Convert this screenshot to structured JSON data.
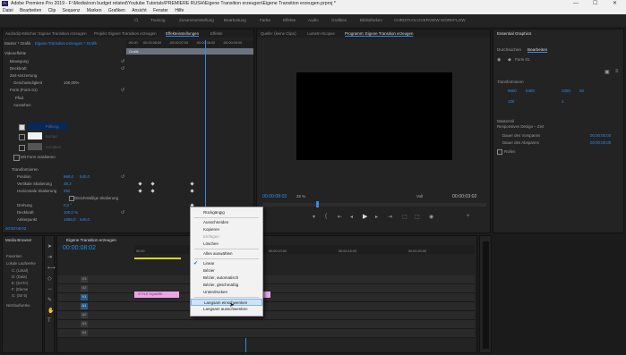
{
  "window": {
    "title": "Adobe Premiere Pro 2019 - F:\\Media\\non budget related\\Youtube Tutorials\\PREMIERE RUSH\\Eigene Transition erzeugen\\Eigene Transition erzeugen.prproj *",
    "app_badge": "Pr",
    "controls": [
      "—",
      "☐",
      "✕"
    ]
  },
  "menubar": [
    "Datei",
    "Bearbeiten",
    "Clip",
    "Sequenz",
    "Marken",
    "Grafiken",
    "Ansicht",
    "Fenster",
    "Hilfe"
  ],
  "workspaces": [
    "Training",
    "Zusammenstellung",
    "Bearbeitung",
    "Farbe",
    "Effekte",
    "Audio",
    "Grafiken",
    "Bibliotheken",
    "CHRISTIAN OVERVIEW WORKFLOW"
  ],
  "effects_panel": {
    "tabs": [
      "Audioclip-Mischer: Eigene Transition erzeugen",
      "Projekt: Eigene Transition erzeugen",
      "Effekteinstellungen",
      "Effekte"
    ],
    "master": "Master * Grafik",
    "sequence": "Eigene Transition erzeugen * Grafik",
    "timecodes": [
      ":00:00",
      ":00:00:06:00",
      ":00:00:07:00",
      ":00:00:08:00",
      ":00:00:09:00"
    ],
    "clip_label": "Grafik",
    "rows": {
      "videoeffekte": "Videoeffekte",
      "bewegung": "Bewegung",
      "deckkraft": "Deckkraft",
      "zeitverzerrung": "Zeit-Verzerrung",
      "geschwindigkeit": "Geschwindigkeit",
      "geschwindigkeit_val": "100,00%",
      "form": "Form (Form 01)",
      "pfad": "Pfad",
      "aussehen": "Aussehen",
      "fuellung": "Füllung",
      "kontur": "Kontur",
      "schatten": "Schatten",
      "maske": "Mit Form maskieren",
      "transformieren": "Transformieren",
      "position": "Position",
      "position_x": "960,0",
      "position_y": "540,0",
      "vert_skal": "Vertikale Skalierung",
      "vert_skal_val": "38,3",
      "horiz_skal": "Horizontale Skalierung",
      "horiz_skal_val": "292",
      "gleich": "Gleichmäßige Skalierung",
      "drehung": "Drehung",
      "drehung_val": "0,0 °",
      "deckkraft2": "Deckkraft",
      "deckkraft2_val": "100,0 %",
      "ankerpunkt": "Ankerpunkt",
      "ankerpunkt_x": "1956,0",
      "ankerpunkt_y": "540,0"
    },
    "current_time": "00:00:08:02"
  },
  "source_tabs": [
    "Quelle: (keine Clips)",
    "Lumetri-Scopes",
    "Programm: Eigene Transition erzeugen"
  ],
  "program": {
    "timecode": "00:00:08:02",
    "zoom": "25 %",
    "quality": "Voll",
    "duration": "00:00:03:02"
  },
  "essential_graphics": {
    "title": "Essential Graphics",
    "tabs": [
      "Durchsuchen",
      "Bearbeiten"
    ],
    "layer": "Form 01",
    "section_transform": "Transformieren",
    "values": [
      "9600",
      "5400",
      "1000",
      "00",
      "100"
    ],
    "scale_label": "1",
    "master_style": "Masterstil",
    "responsive_title": "Responsives Design – Zeit",
    "intro": "Dauer des Vorspanns",
    "outro": "Dauer des Abspanns",
    "intro_val": "00:00:00:00",
    "outro_val": "00:00:00:00",
    "roll": "Rollen"
  },
  "media_browser": {
    "tabs": [
      "Media-Browser"
    ],
    "items": [
      "Favoriten",
      "Lokale Laufwerke",
      "C: (Lokal)",
      "D: (Data)",
      "E: (DATA)",
      "F: (Eleme",
      "G: (Str 5)",
      "Netzlaufwerke"
    ]
  },
  "timeline": {
    "title": "Eigene Transition erzeugen",
    "timecode": "00:00:08:02",
    "ruler": [
      "00:00",
      "00:00:05:00",
      "00:00:10:00",
      "00:00:15:00",
      "00:00:20:00"
    ],
    "tracks": [
      "V3",
      "V2",
      "V1",
      "A1",
      "A2",
      "A3",
      "A4"
    ],
    "clips": [
      {
        "track": "V2",
        "label": "STYLE SQUARE"
      },
      {
        "track": "V1",
        "label": ""
      }
    ]
  },
  "context_menu": {
    "items": [
      {
        "label": "Rückgängig",
        "enabled": true,
        "checked": false
      },
      {
        "sep": true
      },
      {
        "label": "Ausschneiden",
        "enabled": true,
        "checked": false
      },
      {
        "label": "Kopieren",
        "enabled": true,
        "checked": false
      },
      {
        "label": "Einfügen",
        "enabled": false,
        "checked": false
      },
      {
        "label": "Löschen",
        "enabled": true,
        "checked": false
      },
      {
        "sep": true
      },
      {
        "label": "Alles auswählen",
        "enabled": true,
        "checked": false
      },
      {
        "sep": true
      },
      {
        "label": "Linear",
        "enabled": true,
        "checked": true
      },
      {
        "label": "Bézier",
        "enabled": true,
        "checked": false
      },
      {
        "label": "Bézier, automatisch",
        "enabled": true,
        "checked": false
      },
      {
        "label": "Bézier, gleichmäßig",
        "enabled": true,
        "checked": false
      },
      {
        "label": "Unterdrücken",
        "enabled": true,
        "checked": false
      },
      {
        "sep": true
      },
      {
        "label": "Langsam einschwenken",
        "enabled": true,
        "checked": false,
        "highlight": true
      },
      {
        "label": "Langsam ausschwenken",
        "enabled": true,
        "checked": false
      }
    ]
  }
}
